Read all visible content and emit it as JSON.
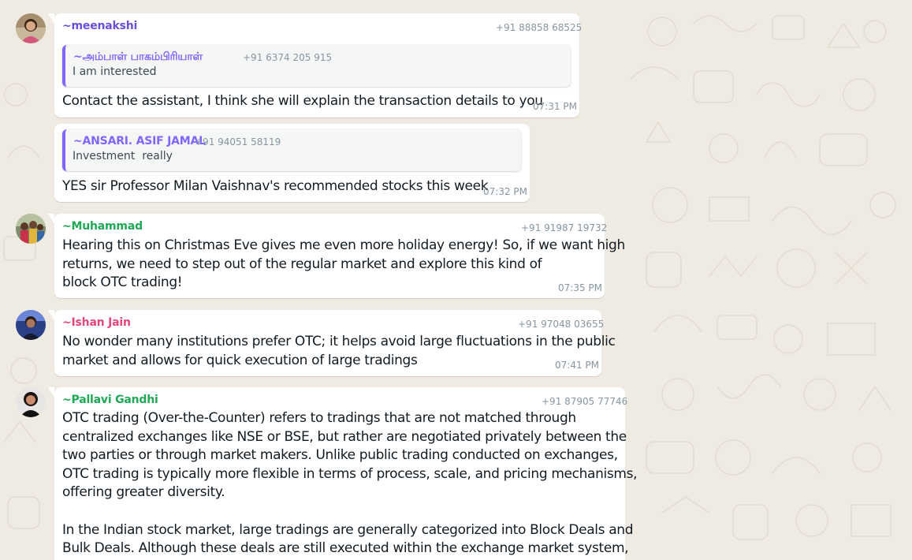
{
  "colors": {
    "background": "#efeae2",
    "bubble": "#ffffff",
    "meta_text": "#8696a0",
    "quote_accent": "#7f66ff"
  },
  "messages": [
    {
      "sender": "~meenakshi",
      "sender_color": "#6b4fd8",
      "phone": "+91 88858 68525",
      "avatar_icon": "woman-portrait-avatar",
      "quote": {
        "name": "~அம்பாள் பாகம்பிரியாள்",
        "phone": "+91 6374 205 915",
        "text": "I am interested"
      },
      "lines": [
        "Contact the assistant, I think she will explain the transaction details to you"
      ],
      "time": "07:31 PM"
    },
    {
      "sender": "",
      "phone": "",
      "quote": {
        "name": "~ANSARI. ASIF JAMAL",
        "phone": "+91 94051 58119",
        "text": "Investment  really"
      },
      "lines": [
        "YES sir Professor Milan Vaishnav's recommended stocks this week"
      ],
      "time": "07:32 PM"
    },
    {
      "sender": "~Muhammad",
      "sender_color": "#1fa855",
      "phone": "+91 91987 19732",
      "avatar_icon": "group-photo-avatar",
      "lines": [
        "Hearing this on Christmas Eve gives me even more holiday energy! So, if we want high",
        "returns, we need to step out of the regular market and explore this kind of",
        "block OTC trading!"
      ],
      "time": "07:35 PM"
    },
    {
      "sender": "~Ishan Jain",
      "sender_color": "#e5457d",
      "phone": "+91 97048 03655",
      "avatar_icon": "man-portrait-avatar",
      "lines": [
        "No wonder many institutions prefer OTC; it helps avoid large fluctuations in the public",
        "market and allows for quick execution of large tradings"
      ],
      "time": "07:41 PM"
    },
    {
      "sender": "~Pallavi Gandhi",
      "sender_color": "#1fa855",
      "phone": "+91 87905 77746",
      "avatar_icon": "woman-portrait-avatar",
      "lines": [
        "OTC trading (Over-the-Counter) refers to tradings that are not matched through",
        "centralized exchanges like NSE or BSE, but rather are negotiated privately between the",
        "two parties or through market makers. Unlike public trading conducted on exchanges,",
        "OTC trading is typically more flexible in terms of process, scale, and pricing mechanisms,",
        "offering greater diversity.",
        "",
        "In the Indian stock market, large tradings are generally categorized into Block Deals and",
        "Bulk Deals. Although these deals are still executed within the exchange market system,"
      ],
      "time": ""
    }
  ]
}
